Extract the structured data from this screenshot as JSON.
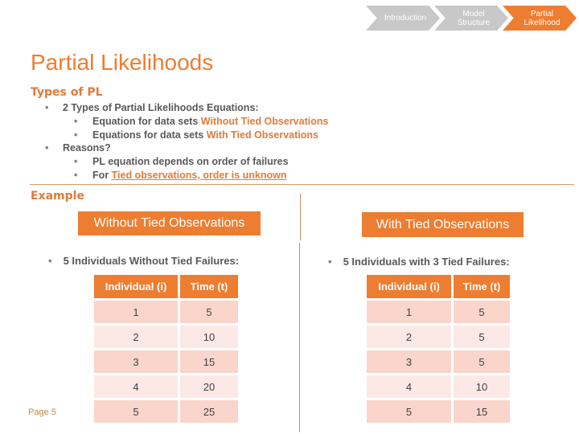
{
  "breadcrumb": [
    {
      "label": "Introduction",
      "state": "inactive"
    },
    {
      "label": "Model Structure",
      "state": "inactive"
    },
    {
      "label": "Partial Likelihood",
      "state": "active"
    }
  ],
  "title": "Partial Likelihoods",
  "types_section": {
    "heading": "Types of PL",
    "item1": "2 Types of Partial Likelihoods Equations:",
    "item1_sub1_prefix": "Equation for data sets ",
    "item1_sub1_highlight": "Without Tied Observations",
    "item1_sub2_prefix": "Equations for data sets ",
    "item1_sub2_highlight": "With Tied Observations",
    "item2": "Reasons?",
    "item2_sub1": "PL equation depends on order of failures",
    "item2_sub2_prefix": "For ",
    "item2_sub2_highlight": "Tied observations, order is unknown"
  },
  "example": {
    "heading": "Example",
    "left": {
      "label": "Without Tied Observations",
      "bullet": "5 Individuals Without Tied Failures:",
      "table": {
        "headers": [
          "Individual (i)",
          "Time (t)"
        ],
        "rows": [
          [
            "1",
            "5"
          ],
          [
            "2",
            "10"
          ],
          [
            "3",
            "15"
          ],
          [
            "4",
            "20"
          ],
          [
            "5",
            "25"
          ]
        ]
      }
    },
    "right": {
      "label": "With Tied Observations",
      "bullet": "5 Individuals with 3 Tied Failures:",
      "table": {
        "headers": [
          "Individual (i)",
          "Time (t)"
        ],
        "rows": [
          [
            "1",
            "5"
          ],
          [
            "2",
            "5"
          ],
          [
            "3",
            "5"
          ],
          [
            "4",
            "10"
          ],
          [
            "5",
            "15"
          ]
        ]
      }
    }
  },
  "footer": {
    "page": "Page 5"
  },
  "colors": {
    "accent": "#ed7d31",
    "inactive_nav": "#c8c8c8",
    "row_odd": "#f9d5cb",
    "row_even": "#fce9e5",
    "text": "#595959"
  }
}
